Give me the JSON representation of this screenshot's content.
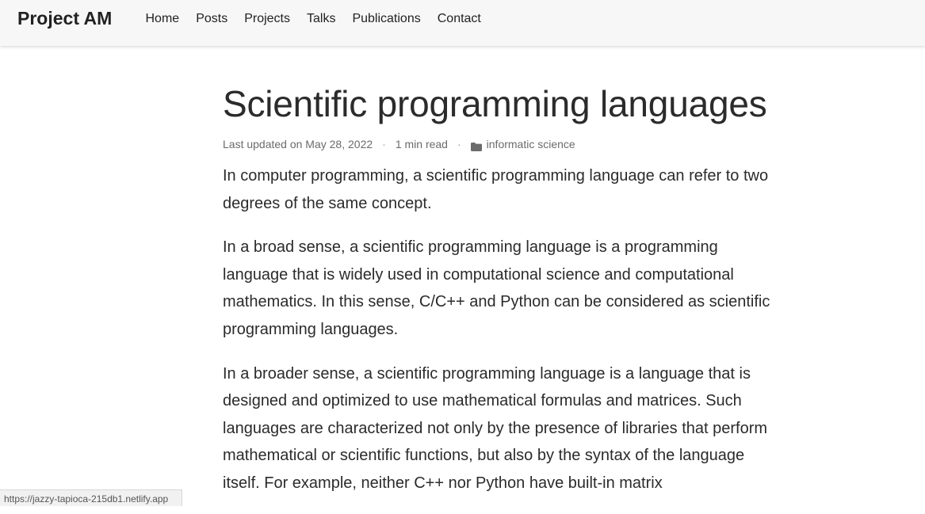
{
  "nav": {
    "brand": "Project AM",
    "links": [
      "Home",
      "Posts",
      "Projects",
      "Talks",
      "Publications",
      "Contact"
    ]
  },
  "article": {
    "title": "Scientific programming languages",
    "meta": {
      "last_updated": "Last updated on May 28, 2022",
      "separator": "·",
      "read_time": "1 min read",
      "category_icon": "folder-icon",
      "category": "informatic science"
    },
    "paragraphs": [
      "In computer programming, a scientific programming language can refer to two degrees of the same concept.",
      "In a broad sense, a scientific programming language is a programming language that is widely used in computational science and computational mathematics. In this sense, C/C++ and Python can be considered as scientific programming languages.",
      "In a broader sense, a scientific programming language is a language that is designed and optimized to use mathematical formulas and matrices. Such languages are characterized not only by the presence of libraries that perform mathematical or scientific functions, but also by the syntax of the language itself. For example, neither C++ nor Python have built-in matrix"
    ]
  },
  "status_bar": {
    "url": "https://jazzy-tapioca-215db1.netlify.app"
  },
  "colors": {
    "navbar_bg": "#f7f7f7",
    "text": "#2b2b2b",
    "meta_text": "#6b6b6b"
  }
}
